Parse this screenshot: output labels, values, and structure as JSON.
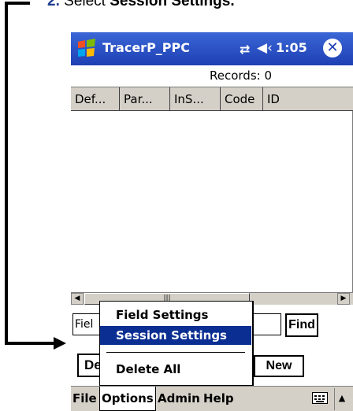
{
  "instruction": {
    "number": "2.",
    "prefix": "Select ",
    "target": "Session Settings."
  },
  "statusbar": {
    "app_title": "TracerP_PPC",
    "connection_icon": "sync-arrows-icon",
    "volume_icon": "speaker-icon",
    "time": "1:05",
    "close_icon": "close-icon"
  },
  "records_label": "Records: 0",
  "table": {
    "columns": [
      "Def...",
      "Par...",
      "InS...",
      "Code",
      "ID"
    ]
  },
  "scrollbar": {
    "left_arrow": "◀",
    "thumb_grip": "|||",
    "right_arrow": "▶"
  },
  "form": {
    "field_value": "Fiel",
    "search_value": "",
    "find_label": "Find",
    "delete_label": "De",
    "new_label": "New"
  },
  "menubar": {
    "items": [
      "File",
      "Options",
      "Admin",
      "Help"
    ],
    "keyboard_icon": "keyboard-icon",
    "sip_arrow": "▲"
  },
  "options_menu": {
    "items": [
      "Field Settings",
      "Session Settings",
      "Delete All"
    ],
    "highlighted": "Session Settings",
    "highlight_color": "#0a2e91"
  },
  "colors": {
    "titlebar": "#1e40b4",
    "instruction_number": "#1f3f8f",
    "chrome": "#d4d0c8"
  }
}
